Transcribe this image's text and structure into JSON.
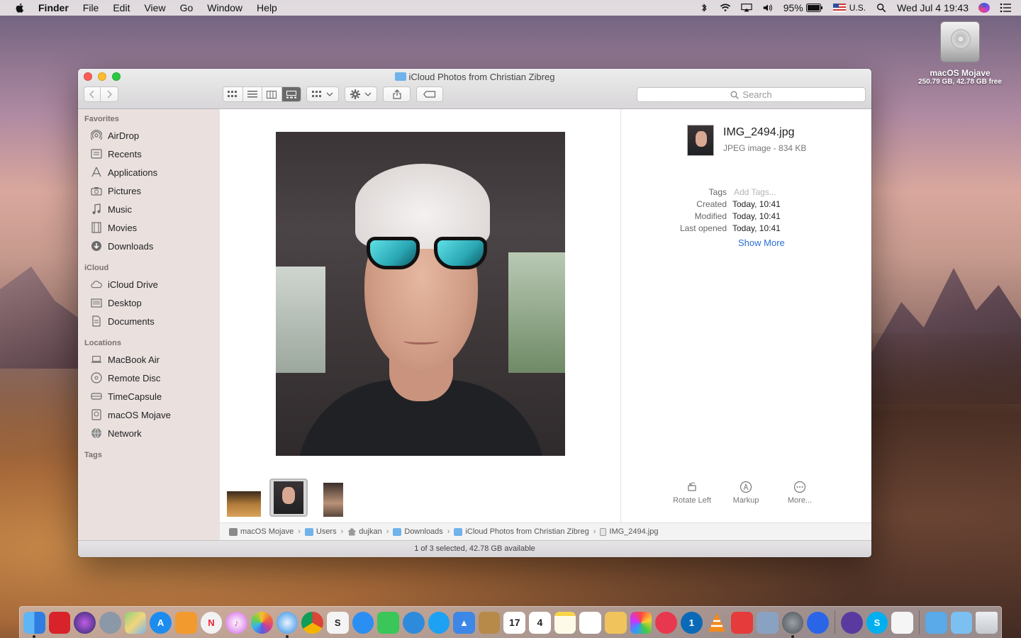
{
  "menubar": {
    "app_name": "Finder",
    "menus": [
      "File",
      "Edit",
      "View",
      "Go",
      "Window",
      "Help"
    ],
    "battery": "95%",
    "input_source": "U.S.",
    "clock": "Wed Jul 4  19:43"
  },
  "desktop": {
    "disk_name": "macOS Mojave",
    "disk_info": "250.79 GB, 42.78 GB free"
  },
  "window": {
    "title": "iCloud Photos from Christian Zibreg",
    "search_placeholder": "Search",
    "sidebar": {
      "favorites_heading": "Favorites",
      "favorites": [
        "AirDrop",
        "Recents",
        "Applications",
        "Pictures",
        "Music",
        "Movies",
        "Downloads"
      ],
      "icloud_heading": "iCloud",
      "icloud": [
        "iCloud Drive",
        "Desktop",
        "Documents"
      ],
      "locations_heading": "Locations",
      "locations": [
        "MacBook Air",
        "Remote Disc",
        "TimeCapsule",
        "macOS Mojave",
        "Network"
      ],
      "tags_heading": "Tags"
    },
    "preview": {
      "file_name": "IMG_2494.jpg",
      "file_kind": "JPEG image - 834 KB",
      "tags_label": "Tags",
      "tags_placeholder": "Add Tags...",
      "created_label": "Created",
      "created_value": "Today, 10:41",
      "modified_label": "Modified",
      "modified_value": "Today, 10:41",
      "opened_label": "Last opened",
      "opened_value": "Today, 10:41",
      "show_more": "Show More",
      "rotate_label": "Rotate Left",
      "markup_label": "Markup",
      "more_label": "More..."
    },
    "path": [
      "macOS Mojave",
      "Users",
      "dujkan",
      "Downloads",
      "iCloud Photos from Christian Zibreg",
      "IMG_2494.jpg"
    ],
    "status": "1 of 3 selected, 42.78 GB available"
  },
  "dock": {
    "calendar_day": "17",
    "reminders_day": "4"
  }
}
